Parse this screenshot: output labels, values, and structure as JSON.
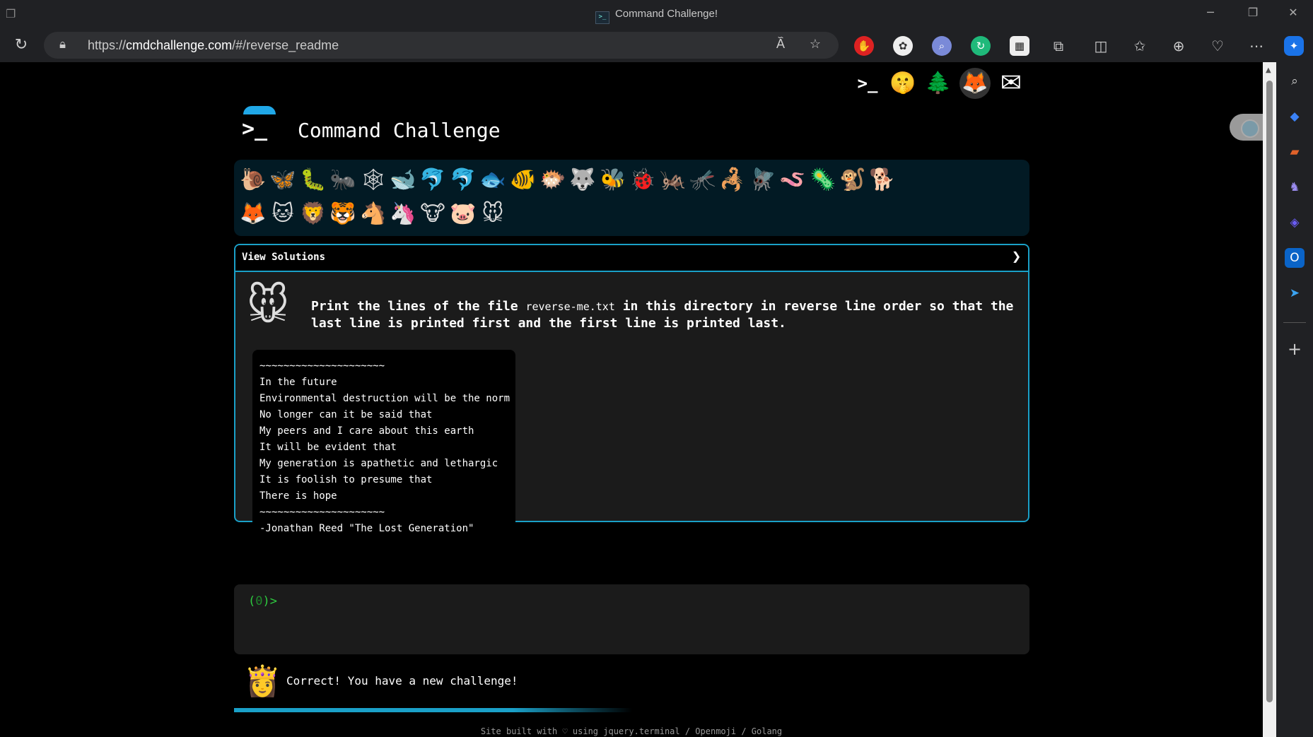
{
  "window": {
    "title": "Command Challenge!",
    "tab_icon": ">_"
  },
  "toolbar": {
    "url_prefix": "https://",
    "url_host": "cmdchallenge.com",
    "url_path": "/#/reverse_readme"
  },
  "top_links": [
    {
      "name": "cmdchallenge-link",
      "glyph": ">_"
    },
    {
      "name": "hint-link",
      "glyph": "🤫"
    },
    {
      "name": "tree-link",
      "glyph": "🌲"
    },
    {
      "name": "gitlab-link",
      "glyph": "🦊"
    },
    {
      "name": "mail-link",
      "glyph": "✉"
    }
  ],
  "header": {
    "title": "Command Challenge",
    "logo_prompt": ">_"
  },
  "challenges": {
    "row1": [
      "🐌",
      "🦋",
      "🐛",
      "🐜",
      "🕸",
      "🐋",
      "🐬",
      "🐬",
      "🐟",
      "🐠",
      "🐡",
      "🐺",
      "🐝",
      "🐞",
      "🦗",
      "🦟",
      "🦂",
      "🪰",
      "🪱",
      "🦠",
      "🐒",
      "🐕"
    ],
    "row2": [
      "🦊",
      "🐱",
      "🦁",
      "🐯",
      "🐴",
      "🦄",
      "🐮",
      "🐷",
      "🐭"
    ]
  },
  "panel": {
    "header_label": "View Solutions",
    "chevron": "❯",
    "avatar": "🐭",
    "description_before": "Print the lines of the file ",
    "description_file": "reverse-me.txt",
    "description_after": " in this directory in reverse line order so that the last line is printed first and the first line is printed last.",
    "poem": [
      "~~~~~~~~~~~~~~~~~~~~~",
      "In the future",
      "Environmental destruction will be the norm",
      "No longer can it be said that",
      "My peers and I care about this earth",
      "It will be evident that",
      "My generation is apathetic and lethargic",
      "It is foolish to presume that",
      "There is hope",
      "~~~~~~~~~~~~~~~~~~~~~",
      "-Jonathan Reed \"The Lost Generation\""
    ]
  },
  "terminal": {
    "prompt_open": "(",
    "prompt_num": "0",
    "prompt_close": ")>"
  },
  "status": {
    "avatar": "👸",
    "message": "Correct! You have a new challenge!",
    "progress": 0.5
  },
  "footer": {
    "text": "Site built with ♡ using jquery.terminal / Openmoji / Golang"
  },
  "colors": {
    "accent": "#1aa0c8",
    "prompt": "#2ecc40",
    "strip_bg": "#021a24"
  }
}
